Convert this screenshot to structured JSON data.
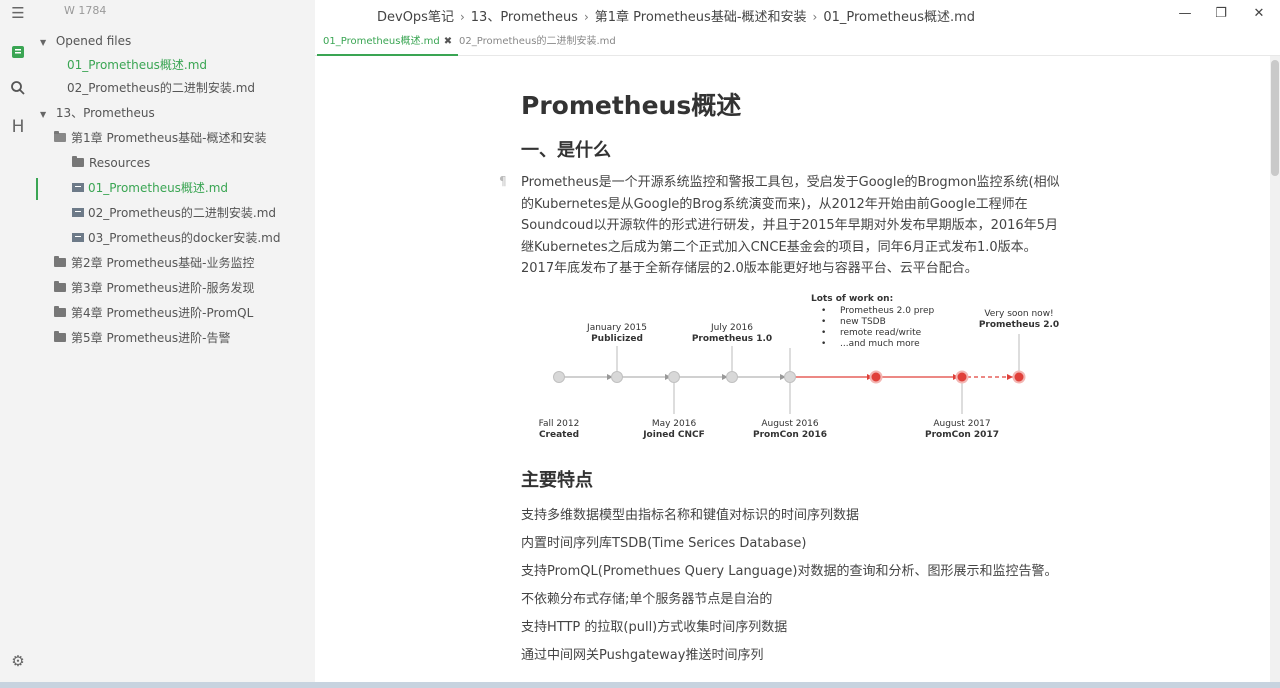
{
  "app": {
    "word_count": "W 1784"
  },
  "sidebar": {
    "opened_files_label": "Opened files",
    "opened_files": [
      {
        "label": "01_Prometheus概述.md",
        "active": true
      },
      {
        "label": "02_Prometheus的二进制安装.md",
        "active": false
      }
    ],
    "tree": [
      {
        "label": "13、Prometheus",
        "type": "folder-root"
      },
      {
        "label": "第1章 Prometheus基础-概述和安装",
        "type": "folder-open"
      },
      {
        "label": "Resources",
        "type": "folder"
      },
      {
        "label": "01_Prometheus概述.md",
        "type": "file",
        "active": true
      },
      {
        "label": "02_Prometheus的二进制安装.md",
        "type": "file"
      },
      {
        "label": "03_Prometheus的docker安装.md",
        "type": "file"
      },
      {
        "label": "第2章 Prometheus基础-业务监控",
        "type": "folder"
      },
      {
        "label": "第3章 Prometheus进阶-服务发现",
        "type": "folder"
      },
      {
        "label": "第4章 Prometheus进阶-PromQL",
        "type": "folder"
      },
      {
        "label": "第5章 Prometheus进阶-告警",
        "type": "folder"
      }
    ]
  },
  "breadcrumb": [
    "DevOps笔记",
    "13、Prometheus",
    "第1章 Prometheus基础-概述和安装",
    "01_Prometheus概述.md"
  ],
  "tabs": [
    {
      "label": "01_Prometheus概述.md",
      "active": true
    },
    {
      "label": "02_Prometheus的二进制安装.md",
      "active": false
    }
  ],
  "doc": {
    "title": "Prometheus概述",
    "section1": "一、是什么",
    "paragraph": "Prometheus是一个开源系统监控和警报工具包，受启发于Google的Brogmon监控系统(相似的Kubernetes是从Google的Brog系统演变而来)，从2012年开始由前Google工程师在Soundcoud以开源软件的形式进行研发，并且于2015年早期对外发布早期版本，2016年5月继Kubernetes之后成为第二个正式加入CNCE基金会的项目，同年6月正式发布1.0版本。2017年底发布了基于全新存储层的2.0版本能更好地与容器平台、云平台配合。",
    "section2": "主要特点",
    "features": [
      "支持多维数据模型由指标名称和键值对标识的时间序列数据",
      "内置时间序列库TSDB(Time Serices Database)",
      "支持PromQL(Promethues Query Language)对数据的查询和分析、图形展示和监控告警。",
      "不依赖分布式存储;单个服务器节点是自治的",
      "支持HTTP 的拉取(pull)方式收集时间序列数据",
      "通过中间网关Pushgateway推送时间序列"
    ]
  },
  "timeline": {
    "top_labels": [
      {
        "date": "January 2015",
        "event": "Publicized"
      },
      {
        "date": "July 2016",
        "event": "Prometheus 1.0"
      },
      {
        "date": "Very soon now!",
        "event": "Prometheus 2.0"
      }
    ],
    "bottom_labels": [
      {
        "date": "Fall 2012",
        "event": "Created"
      },
      {
        "date": "May 2016",
        "event": "Joined CNCF"
      },
      {
        "date": "August 2016",
        "event": "PromCon 2016"
      },
      {
        "date": "August 2017",
        "event": "PromCon 2017"
      }
    ],
    "work_title": "Lots of work on:",
    "work_items": [
      "Prometheus 2.0 prep",
      "new TSDB",
      "remote read/write",
      "...and much more"
    ],
    "colors": {
      "past": "#bdbdbd",
      "future": "#e0403a",
      "node_fill": "#e0403a"
    }
  }
}
